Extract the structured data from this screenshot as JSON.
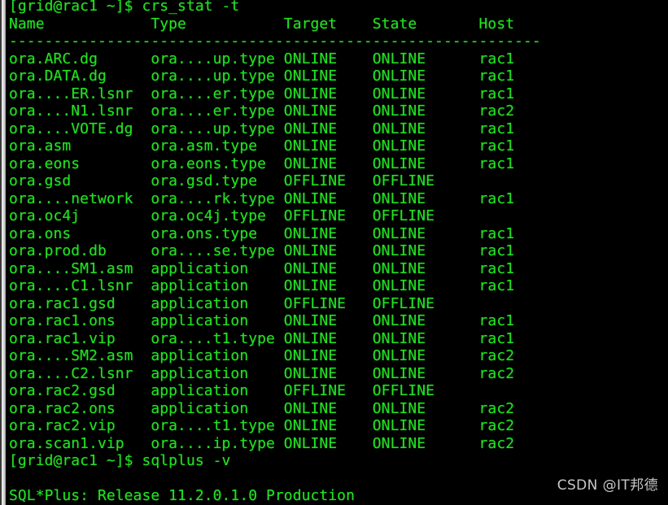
{
  "terminal": {
    "colors": {
      "background": "#000000",
      "foreground": "#21e021",
      "window_bevel": "#d4d4d4",
      "watermark": "#d8d8d8"
    },
    "prompt_top": "[grid@rac1 ~]$ crs_stat -t",
    "prompt_bottom": "[grid@rac1 ~]$ sqlplus -v",
    "blank_line": "",
    "sqlplus_banner": "SQL*Plus: Release 11.2.0.1.0 Production",
    "table": {
      "header": "Name           Type           Target    State     Host",
      "separator": "------------------------------------------------------------",
      "columns": [
        "Name",
        "Type",
        "Target",
        "State",
        "Host"
      ],
      "rows": [
        {
          "name": "ora.ARC.dg",
          "type": "ora....up.type",
          "target": "ONLINE",
          "state": "ONLINE",
          "host": "rac1"
        },
        {
          "name": "ora.DATA.dg",
          "type": "ora....up.type",
          "target": "ONLINE",
          "state": "ONLINE",
          "host": "rac1"
        },
        {
          "name": "ora....ER.lsnr",
          "type": "ora....er.type",
          "target": "ONLINE",
          "state": "ONLINE",
          "host": "rac1"
        },
        {
          "name": "ora....N1.lsnr",
          "type": "ora....er.type",
          "target": "ONLINE",
          "state": "ONLINE",
          "host": "rac2"
        },
        {
          "name": "ora....VOTE.dg",
          "type": "ora....up.type",
          "target": "ONLINE",
          "state": "ONLINE",
          "host": "rac1"
        },
        {
          "name": "ora.asm",
          "type": "ora.asm.type",
          "target": "ONLINE",
          "state": "ONLINE",
          "host": "rac1"
        },
        {
          "name": "ora.eons",
          "type": "ora.eons.type",
          "target": "ONLINE",
          "state": "ONLINE",
          "host": "rac1"
        },
        {
          "name": "ora.gsd",
          "type": "ora.gsd.type",
          "target": "OFFLINE",
          "state": "OFFLINE",
          "host": ""
        },
        {
          "name": "ora....network",
          "type": "ora....rk.type",
          "target": "ONLINE",
          "state": "ONLINE",
          "host": "rac1"
        },
        {
          "name": "ora.oc4j",
          "type": "ora.oc4j.type",
          "target": "OFFLINE",
          "state": "OFFLINE",
          "host": ""
        },
        {
          "name": "ora.ons",
          "type": "ora.ons.type",
          "target": "ONLINE",
          "state": "ONLINE",
          "host": "rac1"
        },
        {
          "name": "ora.prod.db",
          "type": "ora....se.type",
          "target": "ONLINE",
          "state": "ONLINE",
          "host": "rac1"
        },
        {
          "name": "ora....SM1.asm",
          "type": "application",
          "target": "ONLINE",
          "state": "ONLINE",
          "host": "rac1"
        },
        {
          "name": "ora....C1.lsnr",
          "type": "application",
          "target": "ONLINE",
          "state": "ONLINE",
          "host": "rac1"
        },
        {
          "name": "ora.rac1.gsd",
          "type": "application",
          "target": "OFFLINE",
          "state": "OFFLINE",
          "host": ""
        },
        {
          "name": "ora.rac1.ons",
          "type": "application",
          "target": "ONLINE",
          "state": "ONLINE",
          "host": "rac1"
        },
        {
          "name": "ora.rac1.vip",
          "type": "ora....t1.type",
          "target": "ONLINE",
          "state": "ONLINE",
          "host": "rac1"
        },
        {
          "name": "ora....SM2.asm",
          "type": "application",
          "target": "ONLINE",
          "state": "ONLINE",
          "host": "rac2"
        },
        {
          "name": "ora....C2.lsnr",
          "type": "application",
          "target": "ONLINE",
          "state": "ONLINE",
          "host": "rac2"
        },
        {
          "name": "ora.rac2.gsd",
          "type": "application",
          "target": "OFFLINE",
          "state": "OFFLINE",
          "host": ""
        },
        {
          "name": "ora.rac2.ons",
          "type": "application",
          "target": "ONLINE",
          "state": "ONLINE",
          "host": "rac2"
        },
        {
          "name": "ora.rac2.vip",
          "type": "ora....t1.type",
          "target": "ONLINE",
          "state": "ONLINE",
          "host": "rac2"
        },
        {
          "name": "ora.scan1.vip",
          "type": "ora....ip.type",
          "target": "ONLINE",
          "state": "ONLINE",
          "host": "rac2"
        }
      ]
    }
  },
  "watermark": {
    "text": "CSDN @IT邦德"
  }
}
